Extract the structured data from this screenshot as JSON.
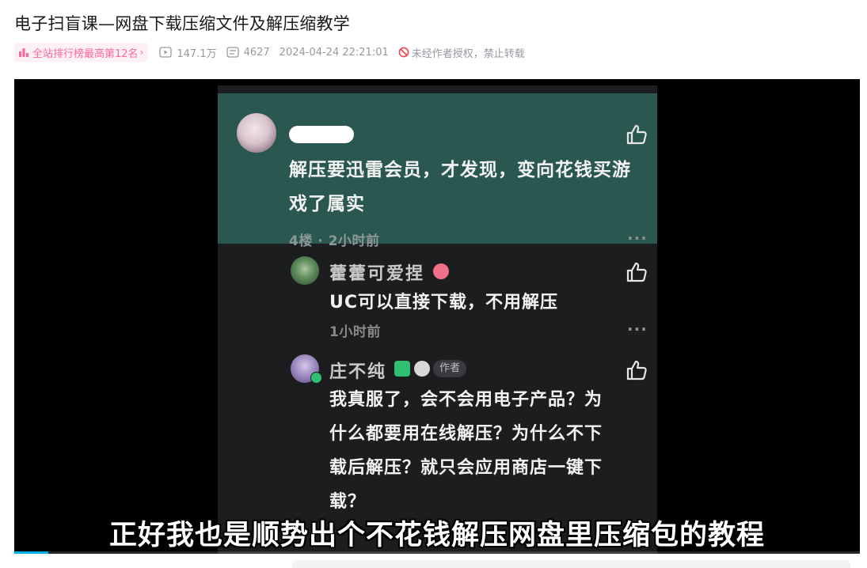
{
  "video": {
    "title": "电子扫盲课—网盘下载压缩文件及解压缩教学",
    "rank_badge": "全站排行榜最高第12名",
    "views": "147.1万",
    "danmaku": "4627",
    "datetime": "2024-04-24 22:21:01",
    "notice": "未经作者授权，禁止转载",
    "progress": 0.04
  },
  "frame": {
    "top_comment": {
      "text_line1": "解压要迅雷会员，才发现，变向花钱买游",
      "text_line2": "戏了属实",
      "meta": "4楼 · 2小时前",
      "more": "···"
    },
    "reply1": {
      "username": "藿藿可爱捏",
      "text": "UC可以直接下载，不用解压",
      "time": "1小时前",
      "more": "···"
    },
    "reply2": {
      "username": "庄不纯",
      "author_tag": "作者",
      "line1": "我真服了，会不会用电子产品？为",
      "line2": "什么都要用在线解压？为什么不下",
      "line3": "载后解压？就只会应用商店一键下",
      "line4": "载？"
    },
    "subtitle": "正好我也是顺势出个不花钱解压网盘里压缩包的教程"
  },
  "colors": {
    "accent": "#00aeec",
    "rank_pink": "#ff6699",
    "comment_highlight": "#2a5851",
    "meta_gray": "#9499a0"
  }
}
